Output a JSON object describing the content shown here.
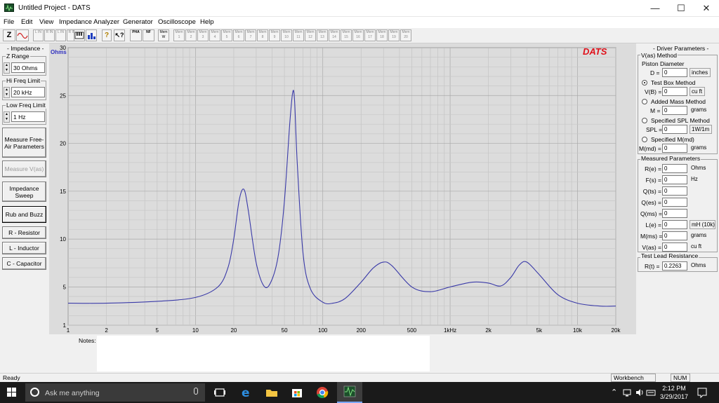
{
  "window": {
    "title": "Untitled Project - DATS",
    "minimize_glyph": "—",
    "maximize_glyph": "☐",
    "close_glyph": "✕"
  },
  "menu": [
    "File",
    "Edit",
    "View",
    "Impedance Analyzer",
    "Generator",
    "Oscilloscope",
    "Help"
  ],
  "toolbar": {
    "z_label": "Z",
    "buttons": [
      "L IN",
      "R IN",
      "L IN",
      "R IN"
    ],
    "pha": "PHA",
    "nf": "NF",
    "mem": "Mem W",
    "mem_slot_label": "Mem",
    "mem_slots": [
      "1",
      "2",
      "3",
      "4",
      "5",
      "6",
      "7",
      "8",
      "9",
      "10",
      "11",
      "12",
      "13",
      "14",
      "15",
      "16",
      "17",
      "18",
      "19",
      "20"
    ]
  },
  "left_panel": {
    "impedance_label": "- Impedance -",
    "z_range_label": "Z Range",
    "z_range_value": "30 Ohms",
    "hi_freq_label": "Hi Freq Limit",
    "hi_freq_value": "20 kHz",
    "low_freq_label": "Low Freq Limit",
    "low_freq_value": "1 Hz",
    "buttons": {
      "measure_free_air": "Measure Free-Air Parameters",
      "measure_vas": "Measure V(as)",
      "impedance_sweep": "Impedance Sweep",
      "rub_and_buzz": "Rub and Buzz",
      "r_resistor": "R - Resistor",
      "l_inductor": "L - Inductor",
      "c_capacitor": "C - Capacitor"
    }
  },
  "plot": {
    "brand": "DATS",
    "y_unit": "Ohms",
    "curve_color": "#3a3aa8",
    "background": "#dcdcdc"
  },
  "chart_data": {
    "type": "line",
    "title": "",
    "xlabel": "",
    "ylabel": "Ohms",
    "x_scale": "log",
    "xlim": [
      1,
      20000
    ],
    "ylim": [
      1,
      30
    ],
    "grid": true,
    "x_tick_values": [
      1,
      2,
      5,
      10,
      20,
      50,
      100,
      200,
      500,
      1000,
      2000,
      5000,
      10000,
      20000
    ],
    "x_tick_labels": [
      "1",
      "2",
      "5",
      "10",
      "20",
      "50",
      "100",
      "200",
      "500",
      "1kHz",
      "2k",
      "5k",
      "10k",
      "20k"
    ],
    "y_tick_values": [
      1,
      5,
      10,
      15,
      20,
      25,
      30
    ],
    "y_tick_labels": [
      "1",
      "5",
      "10",
      "15",
      "20",
      "25",
      "30"
    ],
    "series": [
      {
        "name": "",
        "x": [
          1,
          2,
          5,
          10,
          15,
          18,
          20,
          22,
          24,
          26,
          30,
          35,
          40,
          45,
          50,
          55,
          58,
          60,
          63,
          70,
          80,
          100,
          120,
          150,
          200,
          250,
          300,
          350,
          500,
          700,
          1000,
          1500,
          2000,
          2500,
          3000,
          3500,
          4000,
          5000,
          7000,
          10000,
          15000,
          20000
        ],
        "y": [
          3.3,
          3.3,
          3.5,
          3.9,
          5.0,
          7.0,
          10.0,
          14.0,
          15.2,
          13.0,
          7.5,
          5.0,
          5.8,
          8.5,
          14.0,
          22.0,
          25.3,
          24.5,
          18.0,
          8.5,
          4.8,
          3.4,
          3.3,
          3.8,
          5.5,
          7.0,
          7.6,
          7.2,
          5.0,
          4.5,
          5.0,
          5.5,
          5.4,
          5.1,
          6.0,
          7.3,
          7.6,
          6.3,
          4.2,
          3.3,
          3.0,
          3.0
        ]
      }
    ]
  },
  "notes": {
    "label": "Notes:",
    "value": ""
  },
  "right_panel": {
    "title": "- Driver Parameters -",
    "vas_method": "V(as) Method",
    "piston_diameter": "Piston Diameter",
    "d_label": "D =",
    "d_value": "0",
    "d_unit": "inches",
    "test_box": "Test Box Method",
    "vb_label": "V(B) =",
    "vb_value": "0",
    "vb_unit": "cu ft",
    "added_mass": "Added Mass Method",
    "m_label": "M =",
    "m_value": "0",
    "m_unit": "grams",
    "spl_method": "Specified SPL Method",
    "spl_label": "SPL =",
    "spl_value": "0",
    "spl_unit": "1W/1m",
    "specified_mmd": "Specified M(md)",
    "mmd_label": "M(md) =",
    "mmd_value": "0",
    "mmd_unit": "grams",
    "measured_title": "Measured Parameters",
    "measured": [
      {
        "label": "R(e) =",
        "value": "0",
        "unit": "Ohms"
      },
      {
        "label": "F(s) =",
        "value": "0",
        "unit": "Hz"
      },
      {
        "label": "Q(ts) =",
        "value": "0",
        "unit": ""
      },
      {
        "label": "Q(es) =",
        "value": "0",
        "unit": ""
      },
      {
        "label": "Q(ms) =",
        "value": "0",
        "unit": ""
      },
      {
        "label": "L(e) =",
        "value": "0",
        "unit": "mH (10k)"
      },
      {
        "label": "M(ms) =",
        "value": "0",
        "unit": "grams"
      },
      {
        "label": "V(as) =",
        "value": "0",
        "unit": "cu ft"
      }
    ],
    "lead_title": "Test Lead Resistance",
    "rt_label": "R(t) =",
    "rt_value": "0.2263",
    "rt_unit": "Ohms"
  },
  "status": {
    "left": "Ready",
    "workbench": "Workbench",
    "num": "NUM"
  },
  "taskbar": {
    "search_placeholder": "Ask me anything",
    "time": "2:12 PM",
    "date": "3/29/2017",
    "tray_up": "⌃"
  }
}
